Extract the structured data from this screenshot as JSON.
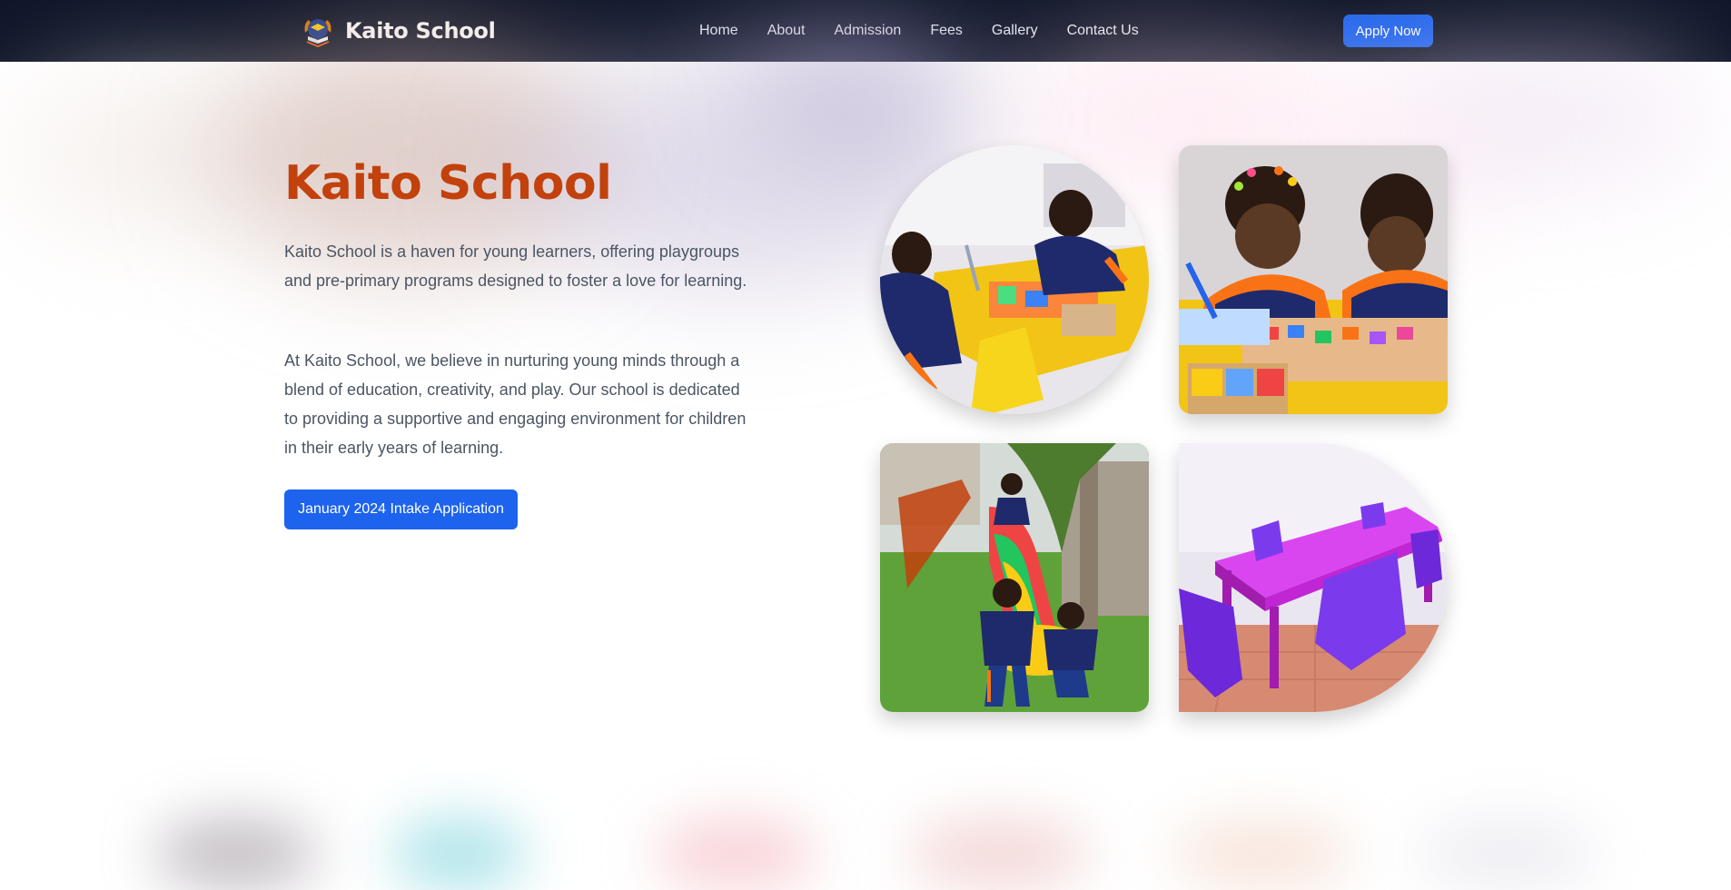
{
  "header": {
    "brand_name": "Kaito School",
    "logo_icon": "school-crest-icon",
    "nav": [
      {
        "label": "Home"
      },
      {
        "label": "About"
      },
      {
        "label": "Admission"
      },
      {
        "label": "Fees"
      },
      {
        "label": "Gallery"
      },
      {
        "label": "Contact Us"
      }
    ],
    "apply_label": "Apply Now"
  },
  "hero": {
    "title": "Kaito School",
    "paragraph_1": "Kaito School is a haven for young learners, offering playgroups and pre-primary programs designed to foster a love for learning.",
    "paragraph_2": "At Kaito School, we believe in nurturing young minds through a blend of education, creativity, and play. Our school is dedicated to providing a supportive and engaging environment for children in their early years of learning.",
    "cta_label": "January 2024 Intake Application"
  },
  "gallery": {
    "images": [
      {
        "subject": "children-at-yellow-table-photo"
      },
      {
        "subject": "girls-writing-with-puzzle-photo"
      },
      {
        "subject": "children-on-playground-slide-photo"
      },
      {
        "subject": "purple-table-and-chairs-photo"
      }
    ]
  },
  "colors": {
    "nav_bg": "#0f1629",
    "accent_blue": "#1d63ed",
    "title_orange": "#c2410c",
    "body_text": "#4b5563"
  }
}
